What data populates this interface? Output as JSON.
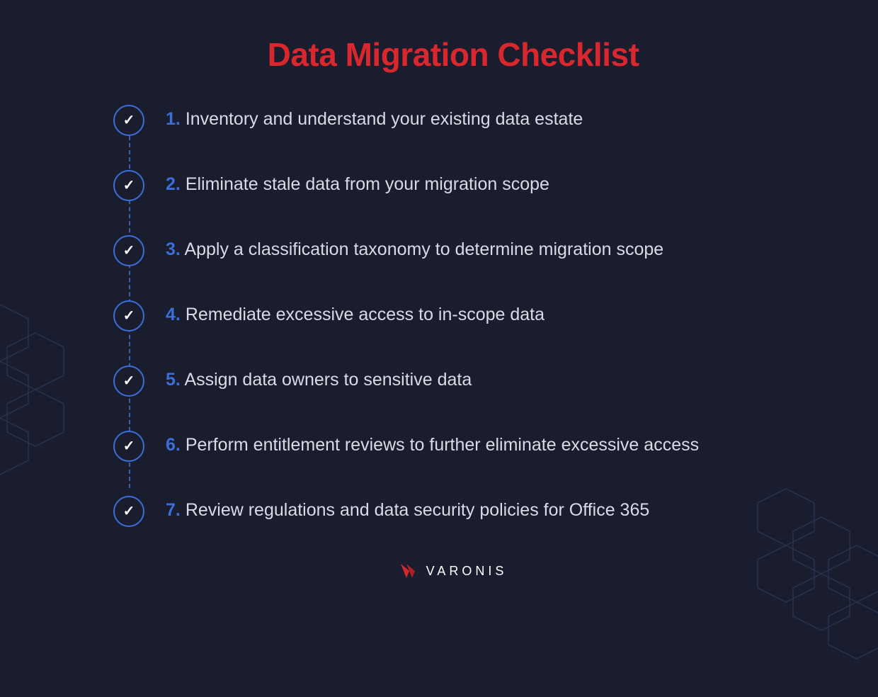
{
  "title": "Data Migration Checklist",
  "items": [
    {
      "num": "1.",
      "text": "Inventory and understand your existing data estate"
    },
    {
      "num": "2.",
      "text": "Eliminate stale data from your migration scope"
    },
    {
      "num": "3.",
      "text": "Apply a classification taxonomy to determine migration scope"
    },
    {
      "num": "4.",
      "text": "Remediate excessive access to in-scope data"
    },
    {
      "num": "5.",
      "text": "Assign data owners to sensitive data"
    },
    {
      "num": "6.",
      "text": "Perform entitlement reviews to further eliminate excessive access"
    },
    {
      "num": "7.",
      "text": "Review regulations and data security policies for Office 365"
    }
  ],
  "brand": "VARONIS",
  "colors": {
    "accent_red": "#d9272e",
    "accent_blue": "#3a6fd8",
    "background": "#1a1d2e"
  }
}
